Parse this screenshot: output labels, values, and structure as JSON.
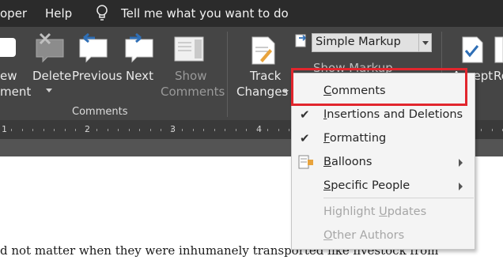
{
  "menubar": {
    "items": [
      "oper",
      "Help"
    ],
    "tell_me": "Tell me what you want to do"
  },
  "ribbon": {
    "new_comment": [
      "ew",
      "ment"
    ],
    "delete": "Delete",
    "previous": "Previous",
    "next": "Next",
    "show_comments": [
      "Show",
      "Comments"
    ],
    "group_comments": "Comments",
    "track_changes": [
      "Track",
      "Changes"
    ],
    "markup_mode": "Simple Markup",
    "show_markup": "Show Markup",
    "accept": "Accept",
    "reject_partial": "Re"
  },
  "ruler": {
    "numbers": [
      "1",
      "2",
      "3",
      "4"
    ]
  },
  "menu": {
    "items": [
      {
        "label": "Comments",
        "checked": false,
        "submenu": false,
        "disabled": false
      },
      {
        "label": "Insertions and Deletions",
        "checked": true,
        "submenu": false,
        "disabled": false
      },
      {
        "label": "Formatting",
        "checked": true,
        "submenu": false,
        "disabled": false
      },
      {
        "label": "Balloons",
        "checked": false,
        "submenu": true,
        "disabled": false
      },
      {
        "label": "Specific People",
        "checked": false,
        "submenu": true,
        "disabled": false
      },
      {
        "label": "Highlight Updates",
        "checked": false,
        "submenu": false,
        "disabled": true
      },
      {
        "label": "Other Authors",
        "checked": false,
        "submenu": false,
        "disabled": true
      }
    ]
  },
  "document": {
    "line": "d not matter when they were inhumanely transported like livestock from"
  },
  "colors": {
    "highlight": "#e1262d",
    "accent_blue": "#2f6fb6"
  }
}
